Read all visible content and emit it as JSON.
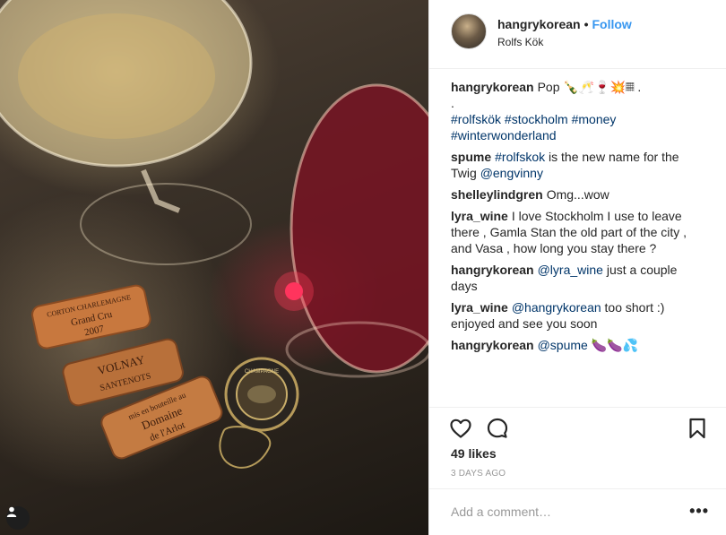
{
  "post": {
    "username": "hangrykorean",
    "separator": "•",
    "follow_label": "Follow",
    "location": "Rolfs Kök",
    "caption": {
      "user": "hangrykorean",
      "text": "Pop 🍾🥂🍷💥𝄜 .",
      "line2": ".",
      "tags_line1": "#rolfskök #stockholm #money",
      "tags_line2": "#winterwonderland"
    },
    "comments": [
      {
        "user": "spume",
        "tag": "#rolfskok",
        "text": " is the new name for the Twig ",
        "mention": "@engvinny"
      },
      {
        "user": "shelleylindgren",
        "text": "Omg...wow"
      },
      {
        "user": "lyra_wine",
        "text": "I love Stockholm I use to leave there , Gamla Stan the old part of the city , and Vasa , how long you stay there ?"
      },
      {
        "user": "hangrykorean",
        "mention": "@lyra_wine",
        "text": " just a couple days"
      },
      {
        "user": "lyra_wine",
        "mention": "@hangrykorean",
        "text": " too short :) enjoyed and see you soon"
      },
      {
        "user": "hangrykorean",
        "mention": "@spume",
        "text": " 🍆🍆💦"
      }
    ],
    "likes": "49 likes",
    "time": "3 DAYS AGO",
    "comment_placeholder": "Add a comment…",
    "more_label": "•••"
  },
  "photo": {
    "cork_labels": {
      "cork1_line1": "CORTON CHARLEMAGNE",
      "cork1_line2": "Grand Cru",
      "cork1_line3": "2007",
      "cork2_line1": "VOLNAY",
      "cork2_line2": "SANTENOTS",
      "cork3_line1": "mis en bouteille au",
      "cork3_line2": "Domaine",
      "cork3_line3": "de l'Arlot",
      "cap_text": "CHAMPAGNE"
    }
  },
  "icons": {
    "like": "heart-icon",
    "comment": "comment-bubble-icon",
    "save": "bookmark-icon",
    "user_tag": "user-tag-icon"
  },
  "colors": {
    "link": "#003569",
    "follow": "#3897f0",
    "muted": "#999999",
    "border": "#efefef",
    "text": "#262626"
  }
}
